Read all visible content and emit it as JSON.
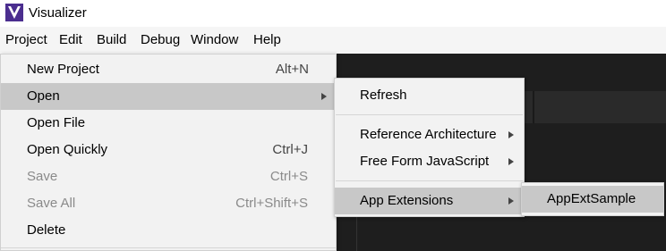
{
  "window": {
    "title": "Visualizer",
    "app_icon": "visualizer-logo-icon",
    "accent": "#4b2e8f"
  },
  "menubar": {
    "items": [
      "Project",
      "Edit",
      "Build",
      "Debug",
      "Window",
      "Help"
    ]
  },
  "project_menu": {
    "items": [
      {
        "label": "New Project",
        "shortcut": "Alt+N"
      },
      {
        "label": "Open",
        "shortcut": "",
        "submenu": true
      },
      {
        "label": "Open File",
        "shortcut": ""
      },
      {
        "label": "Open Quickly",
        "shortcut": "Ctrl+J"
      },
      {
        "label": "Save",
        "shortcut": "Ctrl+S"
      },
      {
        "label": "Save All",
        "shortcut": "Ctrl+Shift+S"
      },
      {
        "label": "Delete",
        "shortcut": ""
      }
    ]
  },
  "open_submenu": {
    "items": [
      {
        "label": "Refresh"
      },
      {
        "label": "Reference Architecture"
      },
      {
        "label": "Free Form JavaScript"
      },
      {
        "label": "App Extensions"
      }
    ]
  },
  "app_extensions_submenu": {
    "items": [
      {
        "label": "AppExtSample"
      }
    ]
  }
}
